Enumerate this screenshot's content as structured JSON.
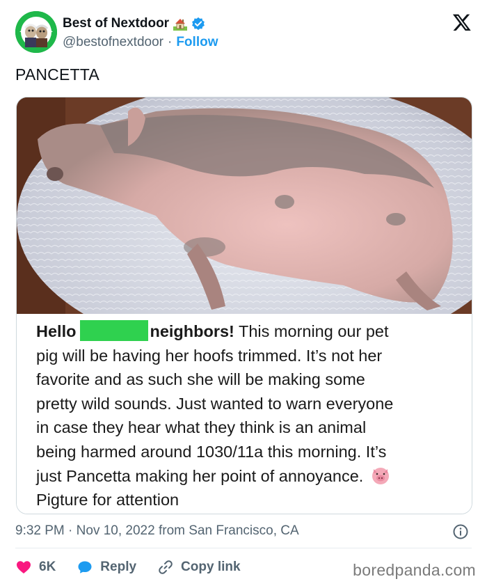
{
  "author": {
    "display_name": "Best of Nextdoor",
    "house_emoji": "house-with-garden-icon",
    "verified": true,
    "handle": "@bestofnextdoor",
    "separator": "·",
    "follow_label": "Follow"
  },
  "platform_icon": "x-logo-icon",
  "tweet": {
    "text": "PANCETTA"
  },
  "screenshot_post": {
    "greeting": "Hello",
    "redaction_color": "#2fd14f",
    "line1_after_redaction": "neighbors!",
    "line1_rest": " This morning our pet",
    "lines": [
      "pig will be having her hoofs trimmed. It’s not her",
      "favorite and as such she will be making some",
      "pretty wild sounds. Just wanted to warn everyone",
      "in case they hear what they think is an animal",
      "being harmed around 1030/11a this morning. It’s",
      "just Pancetta making her point of annoyance."
    ],
    "pig_emoji": "pig-face-icon",
    "last_line": "Pigture for attention"
  },
  "timestamp": {
    "time": "9:32 PM",
    "date": "Nov 10, 2022",
    "location": "from San Francisco, CA",
    "separator": "·"
  },
  "actions": {
    "like_count": "6K",
    "reply_label": "Reply",
    "copy_link_label": "Copy link"
  },
  "watermark": "boredpanda.com",
  "colors": {
    "accent": "#1d9bf0",
    "like": "#f91880",
    "text_secondary": "#536471"
  }
}
